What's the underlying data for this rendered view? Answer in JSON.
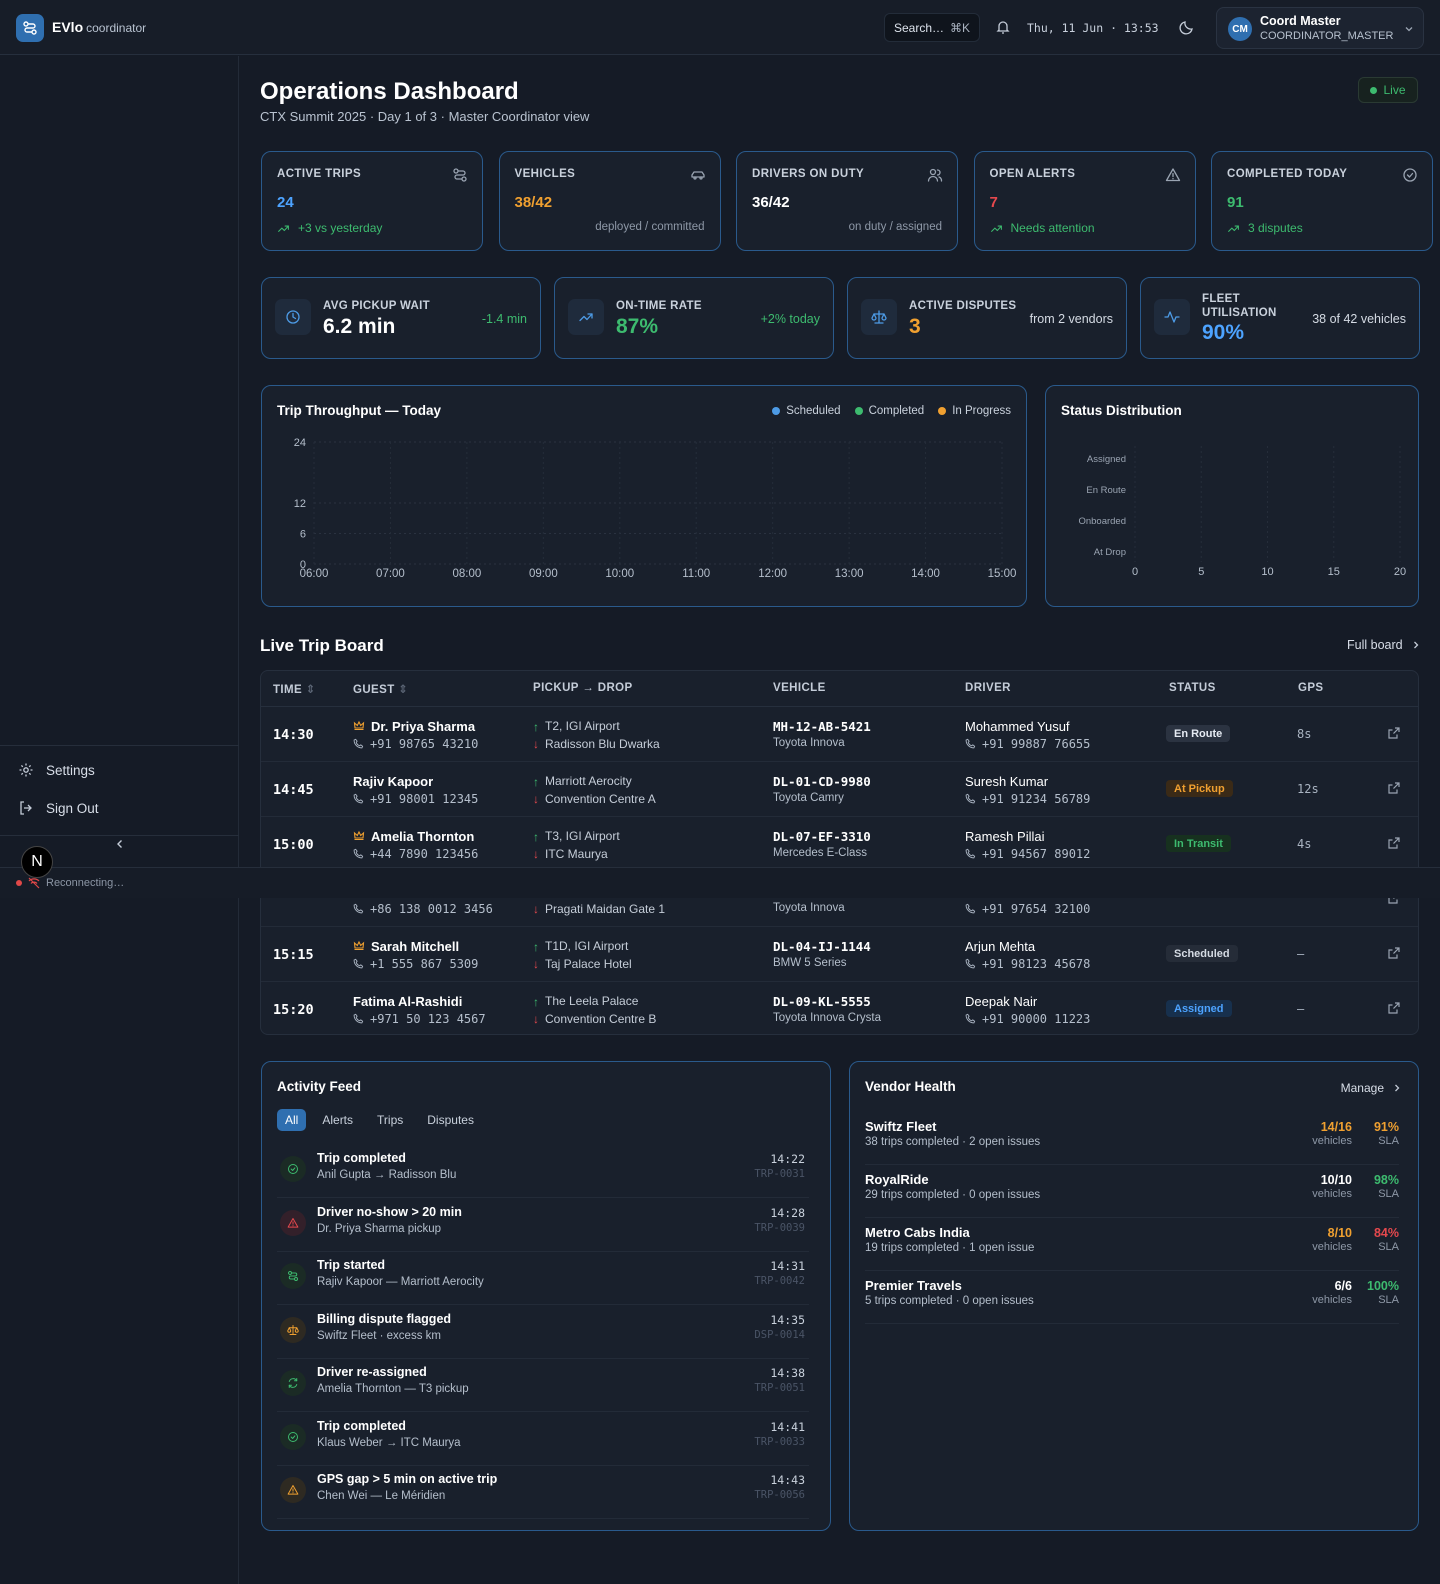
{
  "app": {
    "name": "EVlo",
    "suffix": "coordinator"
  },
  "header": {
    "search_placeholder": "Search…",
    "search_shortcut": "⌘K",
    "datetime": "Thu, 11 Jun · 13:53",
    "user": {
      "initials": "CM",
      "name": "Coord Master",
      "role": "COORDINATOR_MASTER"
    }
  },
  "sidebar": {
    "settings": "Settings",
    "sign_out": "Sign Out",
    "badge": "N",
    "reconnecting": "Reconnecting…"
  },
  "page": {
    "title": "Operations Dashboard",
    "subtitle": "CTX Summit 2025 · Day 1 of 3 · Master Coordinator view",
    "live": "Live"
  },
  "kpis": [
    {
      "label": "ACTIVE TRIPS",
      "value": "24",
      "foot": "+3 vs yesterday",
      "foot_right": "",
      "icon": "route-icon",
      "color": "#4da3ff"
    },
    {
      "label": "VEHICLES",
      "value": "38/42",
      "foot": "",
      "foot_right": "deployed / committed",
      "icon": "car-icon",
      "color": "#f0a030"
    },
    {
      "label": "DRIVERS ON DUTY",
      "value": "36/42",
      "foot": "",
      "foot_right": "on duty / assigned",
      "icon": "users-icon",
      "color": "#ffffff"
    },
    {
      "label": "OPEN ALERTS",
      "value": "7",
      "foot": "Needs attention",
      "foot_right": "",
      "icon": "alert-triangle-icon",
      "color": "#e5484d"
    },
    {
      "label": "COMPLETED TODAY",
      "value": "91",
      "foot": "3 disputes",
      "foot_right": "",
      "icon": "check-circle-icon",
      "color": "#3dbb6f"
    }
  ],
  "metrics": [
    {
      "label": "AVG PICKUP WAIT",
      "value": "6.2 min",
      "right": "-1.4 min",
      "icon": "clock-icon"
    },
    {
      "label": "ON-TIME RATE",
      "value": "87%",
      "right": "+2% today",
      "icon": "trending-up-icon"
    },
    {
      "label": "ACTIVE DISPUTES",
      "value": "3",
      "right": "from 2 vendors",
      "icon": "scale-icon"
    },
    {
      "label": "FLEET UTILISATION",
      "value": "90%",
      "right": "38 of 42 vehicles",
      "icon": "activity-icon"
    }
  ],
  "chart_data": [
    {
      "type": "line",
      "title": "Trip Throughput — Today",
      "x": [
        "06:00",
        "07:00",
        "08:00",
        "09:00",
        "10:00",
        "11:00",
        "12:00",
        "13:00",
        "14:00",
        "15:00"
      ],
      "y_ticks": [
        "0",
        "6",
        "12",
        "24"
      ],
      "ylim": [
        0,
        24
      ],
      "series": [
        {
          "name": "Scheduled",
          "values": [],
          "color": "#4d9be6"
        },
        {
          "name": "Completed",
          "values": [],
          "color": "#3dbb6f"
        },
        {
          "name": "In Progress",
          "values": [],
          "color": "#f0a030"
        }
      ],
      "grid": true,
      "legend": "top-right"
    },
    {
      "type": "bar",
      "title": "Status Distribution",
      "categories": [
        "Assigned",
        "En Route",
        "Onboarded",
        "At Drop"
      ],
      "values": [],
      "x_ticks": [
        "0",
        "5",
        "10",
        "15",
        "20"
      ],
      "xlim": [
        0,
        20
      ],
      "orientation": "horizontal",
      "grid": true
    }
  ],
  "board": {
    "title": "Live Trip Board",
    "full_board": "Full board",
    "headers": {
      "time": "TIME",
      "guest": "GUEST",
      "route": "PICKUP → DROP",
      "vehicle": "VEHICLE",
      "driver": "DRIVER",
      "status": "STATUS",
      "gps": "GPS"
    },
    "rows": [
      {
        "time": "14:30",
        "vip": true,
        "guest": "Dr. Priya Sharma",
        "phone": "+91 98765 43210",
        "pickup": "T2, IGI Airport",
        "drop": "Radisson Blu Dwarka",
        "plate": "MH-12-AB-5421",
        "model": "Toyota Innova",
        "driver": "Mohammed Yusuf",
        "dphone": "+91 99887 76655",
        "status": "En Route",
        "gps": "8s"
      },
      {
        "time": "14:45",
        "vip": false,
        "guest": "Rajiv Kapoor",
        "phone": "+91 98001 12345",
        "pickup": "Marriott Aerocity",
        "drop": "Convention Centre A",
        "plate": "DL-01-CD-9980",
        "model": "Toyota Camry",
        "driver": "Suresh Kumar",
        "dphone": "+91 91234 56789",
        "status": "At Pickup",
        "gps": "12s"
      },
      {
        "time": "15:00",
        "vip": true,
        "guest": "Amelia Thornton",
        "phone": "+44 7890 123456",
        "pickup": "T3, IGI Airport",
        "drop": "ITC Maurya",
        "plate": "DL-07-EF-3310",
        "model": "Mercedes E-Class",
        "driver": "Ramesh Pillai",
        "dphone": "+91 94567 89012",
        "status": "In Transit",
        "gps": "4s"
      },
      {
        "time": "",
        "vip": false,
        "guest": "",
        "phone": "+86 138 0012 3456",
        "pickup": "",
        "drop": "Pragati Maidan Gate 1",
        "plate": "",
        "model": "Toyota Innova",
        "driver": "",
        "dphone": "+91 97654 32100",
        "status": "",
        "gps": ""
      },
      {
        "time": "15:15",
        "vip": true,
        "guest": "Sarah Mitchell",
        "phone": "+1 555 867 5309",
        "pickup": "T1D, IGI Airport",
        "drop": "Taj Palace Hotel",
        "plate": "DL-04-IJ-1144",
        "model": "BMW 5 Series",
        "driver": "Arjun Mehta",
        "dphone": "+91 98123 45678",
        "status": "Scheduled",
        "gps": "–"
      },
      {
        "time": "15:20",
        "vip": false,
        "guest": "Fatima Al-Rashidi",
        "phone": "+971 50 123 4567",
        "pickup": "The Leela Palace",
        "drop": "Convention Centre B",
        "plate": "DL-09-KL-5555",
        "model": "Toyota Innova Crysta",
        "driver": "Deepak Nair",
        "dphone": "+91 90000 11223",
        "status": "Assigned",
        "gps": "–"
      }
    ]
  },
  "status_colors": {
    "En Route": [
      "#e6ebf3",
      "#2b3341"
    ],
    "At Pickup": [
      "#f0a030",
      "#3a2a17"
    ],
    "In Transit": [
      "#3dbb6f",
      "#17311f"
    ],
    "Scheduled": [
      "#d5dbe4",
      "#252c38"
    ],
    "Assigned": [
      "#4da3ff",
      "#17304d"
    ]
  },
  "feed": {
    "title": "Activity Feed",
    "tabs": [
      "All",
      "Alerts",
      "Trips",
      "Disputes"
    ],
    "items": [
      {
        "title": "Trip completed",
        "sub": "Anil Gupta → Radisson Blu",
        "time": "14:22",
        "id": "TRP-0031",
        "icon": "check-circle-icon",
        "kind": "ok"
      },
      {
        "title": "Driver no-show > 20 min",
        "sub": "Dr. Priya Sharma pickup",
        "time": "14:28",
        "id": "TRP-0039",
        "icon": "alert-triangle-icon",
        "kind": "bad"
      },
      {
        "title": "Trip started",
        "sub": "Rajiv Kapoor — Marriott Aerocity",
        "time": "14:31",
        "id": "TRP-0042",
        "icon": "route-icon",
        "kind": "ok"
      },
      {
        "title": "Billing dispute flagged",
        "sub": "Swiftz Fleet · excess km",
        "time": "14:35",
        "id": "DSP-0014",
        "icon": "scale-icon",
        "kind": "warn"
      },
      {
        "title": "Driver re-assigned",
        "sub": "Amelia Thornton — T3 pickup",
        "time": "14:38",
        "id": "TRP-0051",
        "icon": "refresh-icon",
        "kind": "ok"
      },
      {
        "title": "Trip completed",
        "sub": "Klaus Weber → ITC Maurya",
        "time": "14:41",
        "id": "TRP-0033",
        "icon": "check-circle-icon",
        "kind": "ok"
      },
      {
        "title": "GPS gap > 5 min on active trip",
        "sub": "Chen Wei — Le Méridien",
        "time": "14:43",
        "id": "TRP-0056",
        "icon": "alert-triangle-icon",
        "kind": "warn"
      }
    ]
  },
  "vendors": {
    "title": "Vendor Health",
    "manage": "Manage",
    "vehicles_label": "vehicles",
    "sla_label": "SLA",
    "items": [
      {
        "name": "Swiftz Fleet",
        "sub": "38 trips completed · 2 open issues",
        "vehicles": "14/16",
        "sla": "91%",
        "vcolor": "#f0a030",
        "scolor": "#f0a030"
      },
      {
        "name": "RoyalRide",
        "sub": "29 trips completed · 0 open issues",
        "vehicles": "10/10",
        "sla": "98%",
        "vcolor": "#ffffff",
        "scolor": "#3dbb6f"
      },
      {
        "name": "Metro Cabs India",
        "sub": "19 trips completed · 1 open issue",
        "vehicles": "8/10",
        "sla": "84%",
        "vcolor": "#f0a030",
        "scolor": "#e5484d"
      },
      {
        "name": "Premier Travels",
        "sub": "5 trips completed · 0 open issues",
        "vehicles": "6/6",
        "sla": "100%",
        "vcolor": "#ffffff",
        "scolor": "#3dbb6f"
      }
    ]
  }
}
